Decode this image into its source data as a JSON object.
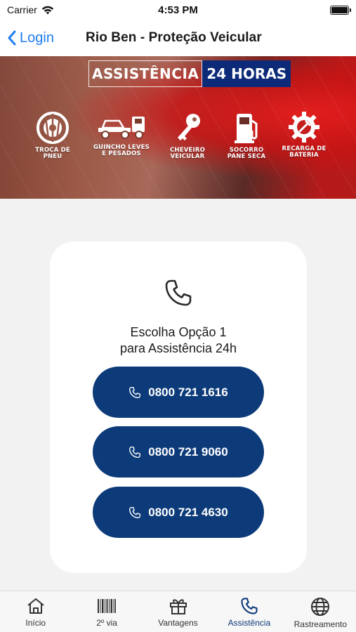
{
  "status_bar": {
    "carrier": "Carrier",
    "time": "4:53 PM"
  },
  "nav": {
    "back_label": "Login",
    "title": "Rio Ben - Proteção Veicular"
  },
  "banner": {
    "title_left": "ASSISTÊNCIA",
    "title_right": "24 HORAS",
    "services": [
      {
        "label_1": "TROCA DE",
        "label_2": "PNEU",
        "icon": "tire-icon"
      },
      {
        "label_1": "GUINCHO LEVES",
        "label_2": "E PESADOS",
        "icon": "tow-truck-icon"
      },
      {
        "label_1": "CHEVEIRO",
        "label_2": "VEICULAR",
        "icon": "key-icon"
      },
      {
        "label_1": "SOCORRO",
        "label_2": "PANE SECA",
        "icon": "fuel-pump-icon"
      },
      {
        "label_1": "RECARGA DE",
        "label_2": "BATERIA",
        "icon": "battery-gear-icon"
      }
    ]
  },
  "card": {
    "line_1": "Escolha Opção 1",
    "line_2": "para Assistência 24h",
    "phones": [
      "0800 721 1616",
      "0800 721 9060",
      "0800 721 4630"
    ]
  },
  "tabs": [
    {
      "label": "Início",
      "icon": "home-icon"
    },
    {
      "label": "2º via",
      "icon": "barcode-icon"
    },
    {
      "label": "Vantagens",
      "icon": "gift-icon"
    },
    {
      "label": "Assistência",
      "icon": "phone-icon",
      "active": true
    },
    {
      "label": "Rastreamento",
      "icon": "globe-icon"
    }
  ],
  "colors": {
    "primary": "#0d3b7a",
    "ios_blue": "#1e7cf0",
    "background": "#f2f2f2"
  }
}
